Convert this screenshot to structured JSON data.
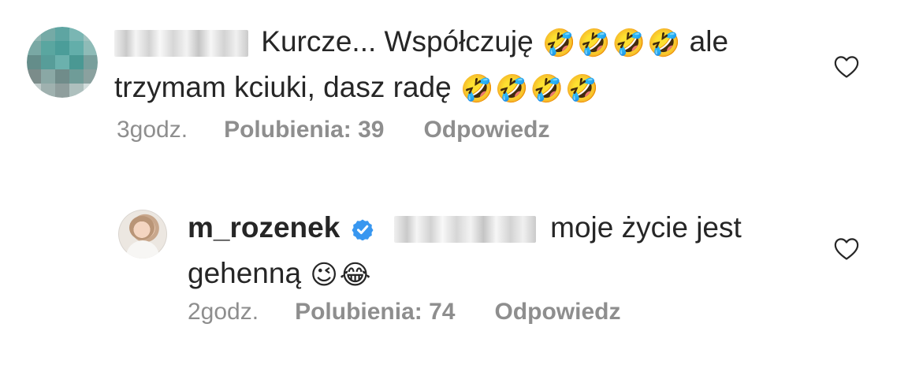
{
  "comments": [
    {
      "text_before_emojis": "Kurcze... Współczuję",
      "laugh_emoji_1": "🤣",
      "laugh_emoji_2": "🤣",
      "laugh_emoji_3": "🤣",
      "laugh_emoji_4": "🤣",
      "text_after_emojis": "ale",
      "text_line_2": "trzymam kciuki, dasz radę",
      "line2_emoji_1": "🤣",
      "line2_emoji_2": "🤣",
      "line2_emoji_3": "🤣",
      "line2_emoji_4": "🤣",
      "time": "3godz.",
      "likes": "Polubienia: 39",
      "reply": "Odpowiedz"
    },
    {
      "username": "m_rozenek",
      "text": "moje życie jest",
      "text_line_2": "gehenną",
      "wink_emoji": "😉",
      "laugh_emoji": "😂",
      "time": "2godz.",
      "likes": "Polubienia: 74",
      "reply": "Odpowiedz"
    }
  ],
  "icons": {
    "verified": "verified-badge-icon",
    "heart": "heart-outline-icon"
  },
  "colors": {
    "text": "#262626",
    "muted": "#8e8e8e",
    "verified": "#3897f0",
    "heart": "#262626"
  }
}
